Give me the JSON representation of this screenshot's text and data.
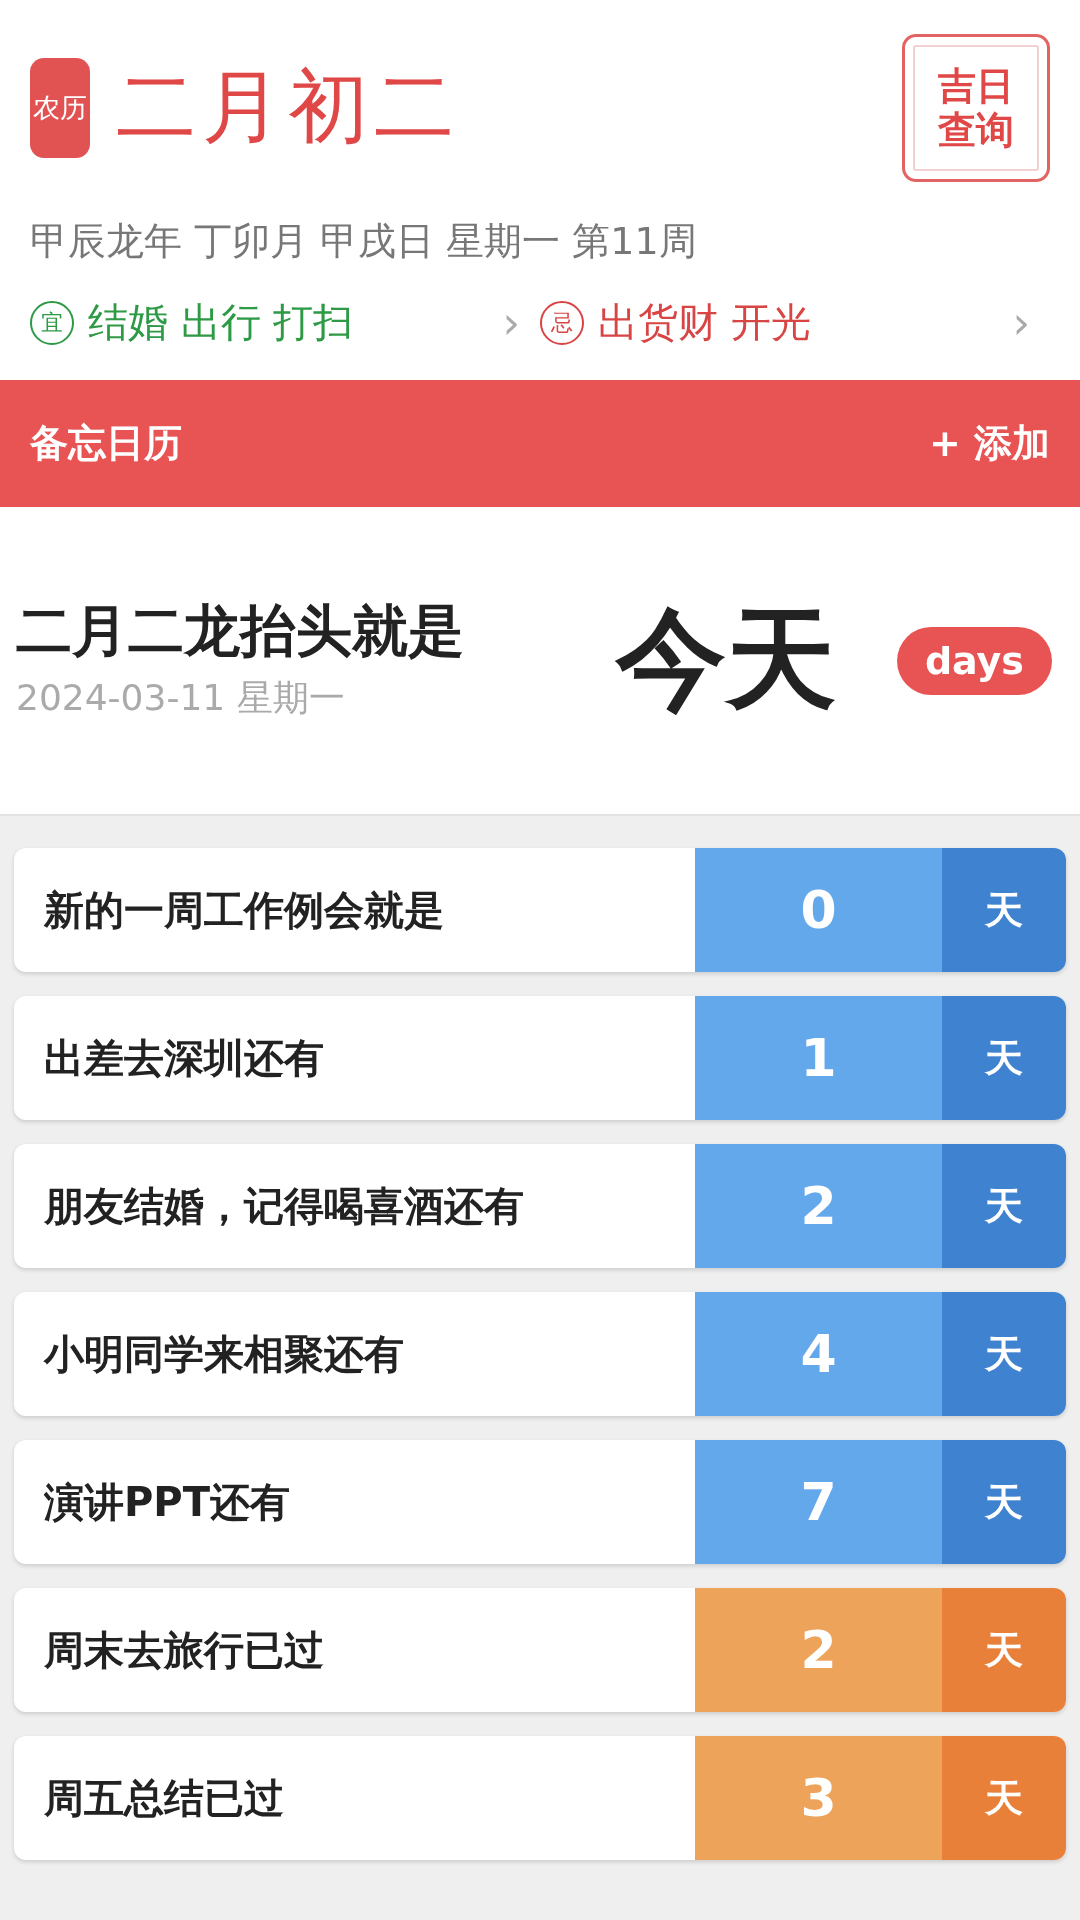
{
  "lunar": {
    "badge": "农历",
    "date": "二月初二",
    "lookup_button": "吉日查询",
    "ganzhi": "甲辰龙年 丁卯月 甲戌日 星期一 第11周"
  },
  "almanac": [
    {
      "kind": "good",
      "mark": "宜",
      "items": "结婚 出行 打扫",
      "arrow": "›"
    },
    {
      "kind": "bad",
      "mark": "忌",
      "items": "出货财 开光",
      "arrow": "›"
    }
  ],
  "memo_bar": {
    "title": "备忘日历",
    "add_button": "+ 添加"
  },
  "featured": {
    "title": "二月二龙抬头就是",
    "date": "2024-03-11 星期一",
    "count": "今天",
    "unit": "days"
  },
  "events": [
    {
      "kind": "upcoming",
      "title": "新的一周工作例会就是",
      "count": "0",
      "unit": "天"
    },
    {
      "kind": "upcoming",
      "title": "出差去深圳还有",
      "count": "1",
      "unit": "天"
    },
    {
      "kind": "upcoming",
      "title": "朋友结婚，记得喝喜酒还有",
      "count": "2",
      "unit": "天"
    },
    {
      "kind": "upcoming",
      "title": "小明同学来相聚还有",
      "count": "4",
      "unit": "天"
    },
    {
      "kind": "upcoming",
      "title": "演讲PPT还有",
      "count": "7",
      "unit": "天"
    },
    {
      "kind": "past",
      "title": "周末去旅行已过",
      "count": "2",
      "unit": "天"
    },
    {
      "kind": "past",
      "title": "周五总结已过",
      "count": "3",
      "unit": "天"
    }
  ]
}
